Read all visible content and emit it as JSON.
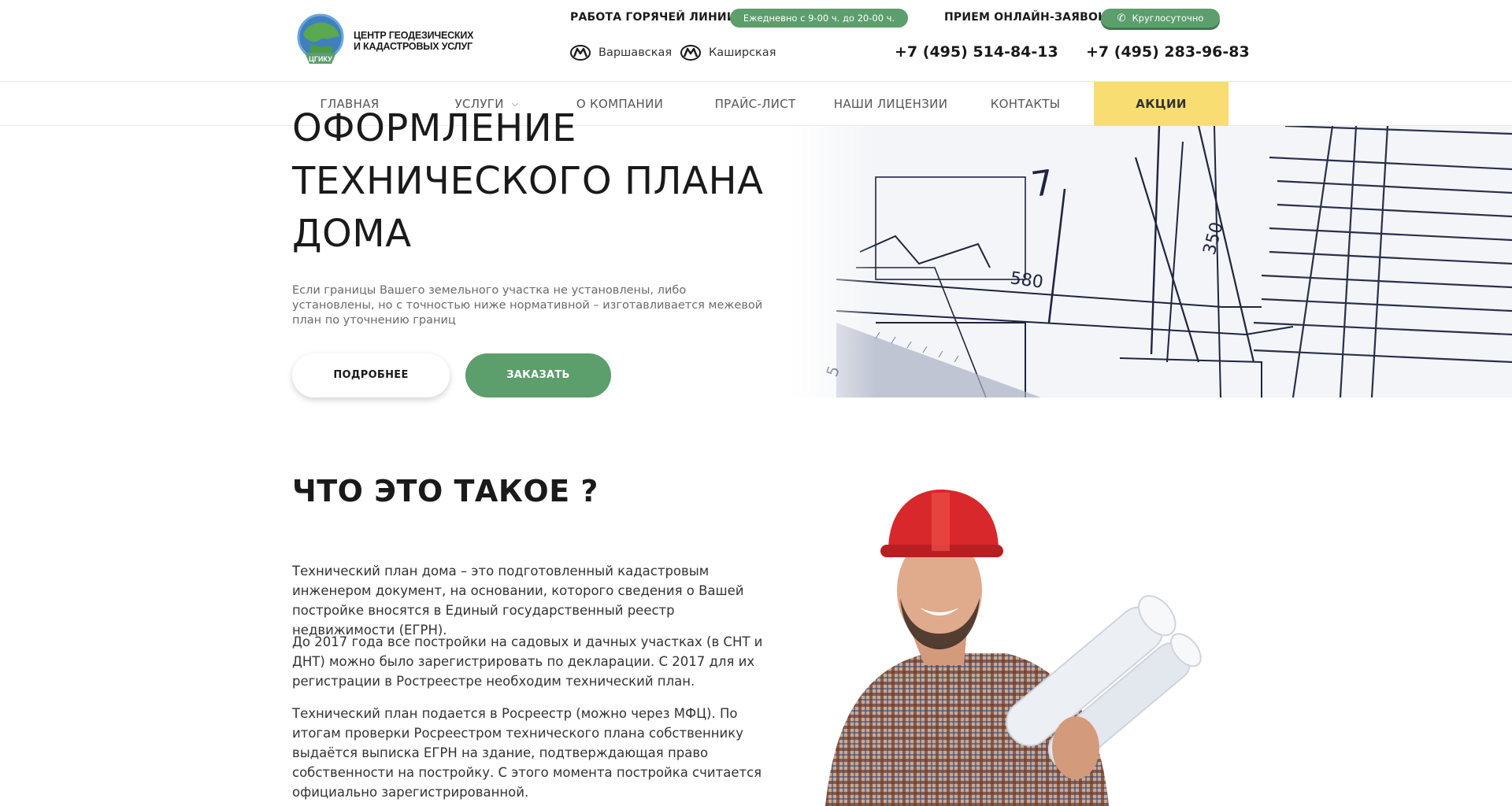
{
  "header": {
    "logo_line1": "ЦЕНТР ГЕОДЕЗИЧЕСКИХ",
    "logo_line2": "И КАДАСТРОВЫХ УСЛУГ",
    "logo_badge": "ЦГИКУ",
    "hotline_label": "РАБОТА ГОРЯЧЕЙ ЛИНИИ:",
    "hotline_hours": "Ежедневно с 9-00 ч. до 20-00 ч.",
    "online_label": "ПРИЕМ ОНЛАЙН-ЗАЯВОК:",
    "online_hours": "Круглосуточно",
    "metro": [
      "Варшавская",
      "Каширская"
    ],
    "phones": [
      "+7 (495) 514-84-13",
      "+7 (495) 283-96-83"
    ]
  },
  "nav": {
    "items": [
      {
        "label": "ГЛАВНАЯ"
      },
      {
        "label": "УСЛУГИ"
      },
      {
        "label": "О КОМПАНИИ"
      },
      {
        "label": "ПРАЙС-ЛИСТ"
      },
      {
        "label": "НАШИ ЛИЦЕНЗИИ"
      },
      {
        "label": "КОНТАКТЫ"
      },
      {
        "label": "АКЦИИ"
      }
    ]
  },
  "hero": {
    "title_line1": "ОФОРМЛЕНИЕ",
    "title_line2": "ТЕХНИЧЕСКОГО ПЛАНА",
    "title_line3": "ДОМА",
    "description": "Если границы Вашего земельного участка не установлены, либо установлены, но с точностью ниже нормативной – изготавливается межевой план по уточнению границ",
    "btn_more": "ПОДРОБНЕЕ",
    "btn_order": "ЗАКАЗАТЬ",
    "drawing_labels": [
      "7",
      "580",
      "350",
      "5"
    ]
  },
  "about": {
    "title": "ЧТО ЭТО ТАКОЕ ?",
    "paragraphs": [
      "Технический план дома – это подготовленный кадастровым инженером документ, на основании, которого сведения о Вашей постройке вносятся в Единый государственный реестр недвижимости (ЕГРН).",
      "До 2017 года все постройки на садовых и дачных участках (в СНТ и ДНТ) можно было зарегистрировать по декларации. С 2017 для их регистрации в Ростреестре необходим технический план.",
      "Технический план подается в Росреестр (можно через МФЦ). По итогам проверки Росреестром технического плана собственнику выдаётся выписка ЕГРН на здание, подтверждающая право собственности на постройку. С этого момента постройка считается официально зарегистрированной."
    ]
  },
  "colors": {
    "accent_green": "#5c9e6c",
    "promo_yellow": "#f7dd72",
    "text_dark": "#1a1a1a"
  },
  "icons": [
    "metro-icon",
    "phone-icon",
    "chevron-down-icon"
  ]
}
